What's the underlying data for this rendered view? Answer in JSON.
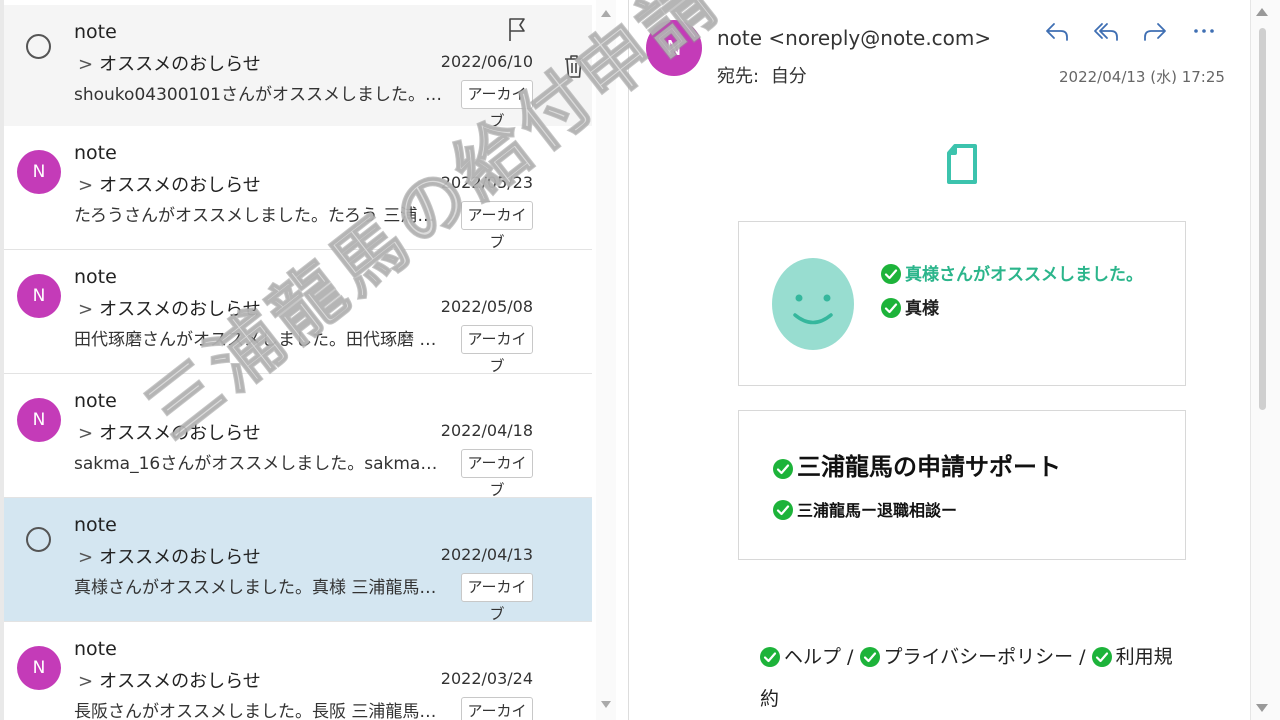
{
  "list": {
    "archive_label": "アーカイブ",
    "messages": [
      {
        "avatar": "",
        "sender": "note",
        "subject": "オススメのおしらせ",
        "date": "2022/06/10",
        "preview": "shouko04300101さんがオススメしました。sho...",
        "state": "hover"
      },
      {
        "avatar": "N",
        "sender": "note",
        "subject": "オススメのおしらせ",
        "date": "2022/05/23",
        "preview": "たろうさんがオススメしました。たろう 三浦龍馬...",
        "state": ""
      },
      {
        "avatar": "N",
        "sender": "note",
        "subject": "オススメのおしらせ",
        "date": "2022/05/08",
        "preview": "田代琢磨さんがオススメしました。田代琢磨 三...",
        "state": ""
      },
      {
        "avatar": "N",
        "sender": "note",
        "subject": "オススメのおしらせ",
        "date": "2022/04/18",
        "preview": "sakma_16さんがオススメしました。sakma_16...",
        "state": ""
      },
      {
        "avatar": "",
        "sender": "note",
        "subject": "オススメのおしらせ",
        "date": "2022/04/13",
        "preview": "真様さんがオススメしました。真様 三浦龍馬の...",
        "state": "selected"
      },
      {
        "avatar": "N",
        "sender": "note",
        "subject": "オススメのおしらせ",
        "date": "2022/03/24",
        "preview": "長阪さんがオススメしました。長阪 三浦龍馬の...",
        "state": ""
      }
    ]
  },
  "reader": {
    "avatar": "N",
    "from": "note <noreply@note.com>",
    "to_label": "宛先:",
    "to_value": "自分",
    "datetime": "2022/04/13 (水) 17:25",
    "recommend_text": "真様さんがオススメしました。",
    "recommender": "真様",
    "magazine_title": "三浦龍馬の申請サポート",
    "magazine_subtitle": "三浦龍馬ー退職相談ー",
    "footer": {
      "help": "ヘルプ",
      "privacy": "プライバシーポリシー",
      "terms": "利用規約",
      "sep": " / "
    }
  },
  "watermark": "三浦龍馬の給付申請サポートサービス",
  "colors": {
    "avatar": "#c43bb8",
    "accent_green": "#2bb58b",
    "check_green": "#1db33a",
    "selected_row": "#d4e6f1",
    "action_blue": "#3f6fb3"
  }
}
